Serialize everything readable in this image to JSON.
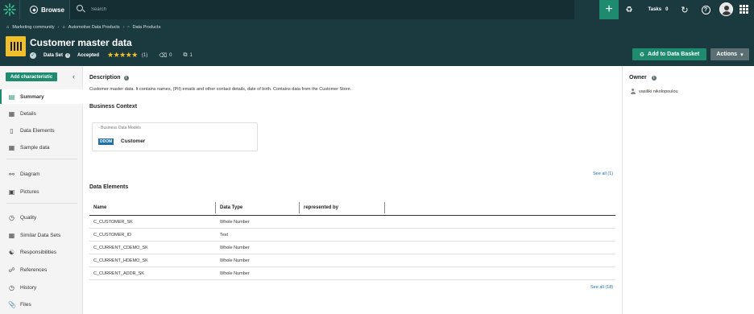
{
  "topbar": {
    "browse_label": "Browse",
    "search_placeholder": "Search",
    "add_label": "+",
    "tasks_label": "Tasks",
    "tasks_count": "0",
    "help_label": "?"
  },
  "breadcrumb": [
    {
      "label": "Marketing community"
    },
    {
      "label": "Automotive Data Products"
    },
    {
      "label": "Data Products"
    }
  ],
  "asset": {
    "title": "Customer master data",
    "type_label": "Data Set",
    "status": "Accepted",
    "stars": "★★★★★",
    "rating_count": "(1)",
    "comments_count": "0",
    "relations_count": "1"
  },
  "buttons": {
    "add_to_basket": "Add to Data Basket",
    "actions": "Actions",
    "add_characteristic": "Add characteristic"
  },
  "sidebar": {
    "items": [
      {
        "label": "Summary",
        "icon": "summary-icon"
      },
      {
        "label": "Details",
        "icon": "details-icon"
      },
      {
        "label": "Data Elements",
        "icon": "data-elements-icon"
      },
      {
        "label": "Sample data",
        "icon": "sample-data-icon"
      },
      {
        "label": "Diagram",
        "icon": "diagram-icon"
      },
      {
        "label": "Pictures",
        "icon": "pictures-icon"
      },
      {
        "label": "Quality",
        "icon": "quality-icon"
      },
      {
        "label": "Similar Data Sets",
        "icon": "similar-icon"
      },
      {
        "label": "Responsibilities",
        "icon": "responsibilities-icon"
      },
      {
        "label": "References",
        "icon": "references-icon"
      },
      {
        "label": "History",
        "icon": "history-icon"
      },
      {
        "label": "Files",
        "icon": "files-icon"
      }
    ]
  },
  "description": {
    "heading": "Description",
    "text": "Customer master data. It contains names, (PII) emails and other contact details, date of birth. Contains data from the Customer Store."
  },
  "business_context": {
    "heading": "Business Context",
    "card_subtitle": "Business Data Models",
    "tag": "DDOM",
    "name": "Customer",
    "see_all": "See all (1)"
  },
  "data_elements": {
    "heading": "Data Elements",
    "columns": [
      "Name",
      "Data Type",
      "represented by"
    ],
    "rows": [
      [
        "C_CUSTOMER_SK",
        "Whole Number",
        ""
      ],
      [
        "C_CUSTOMER_ID",
        "Text",
        ""
      ],
      [
        "C_CURRENT_CDEMO_SK",
        "Whole Number",
        ""
      ],
      [
        "C_CURRENT_HDEMO_SK",
        "Whole Number",
        ""
      ],
      [
        "C_CURRENT_ADDR_SK",
        "Whole Number",
        ""
      ]
    ],
    "see_all": "See all (18)"
  },
  "owner": {
    "heading": "Owner",
    "name": "vasiliki nikolopoulou"
  },
  "colors": {
    "topbar": "#1b3a40",
    "accent": "#1e8a6e",
    "asset_icon": "#f0c02c",
    "star": "#f3c227",
    "link": "#1d6fa5"
  }
}
